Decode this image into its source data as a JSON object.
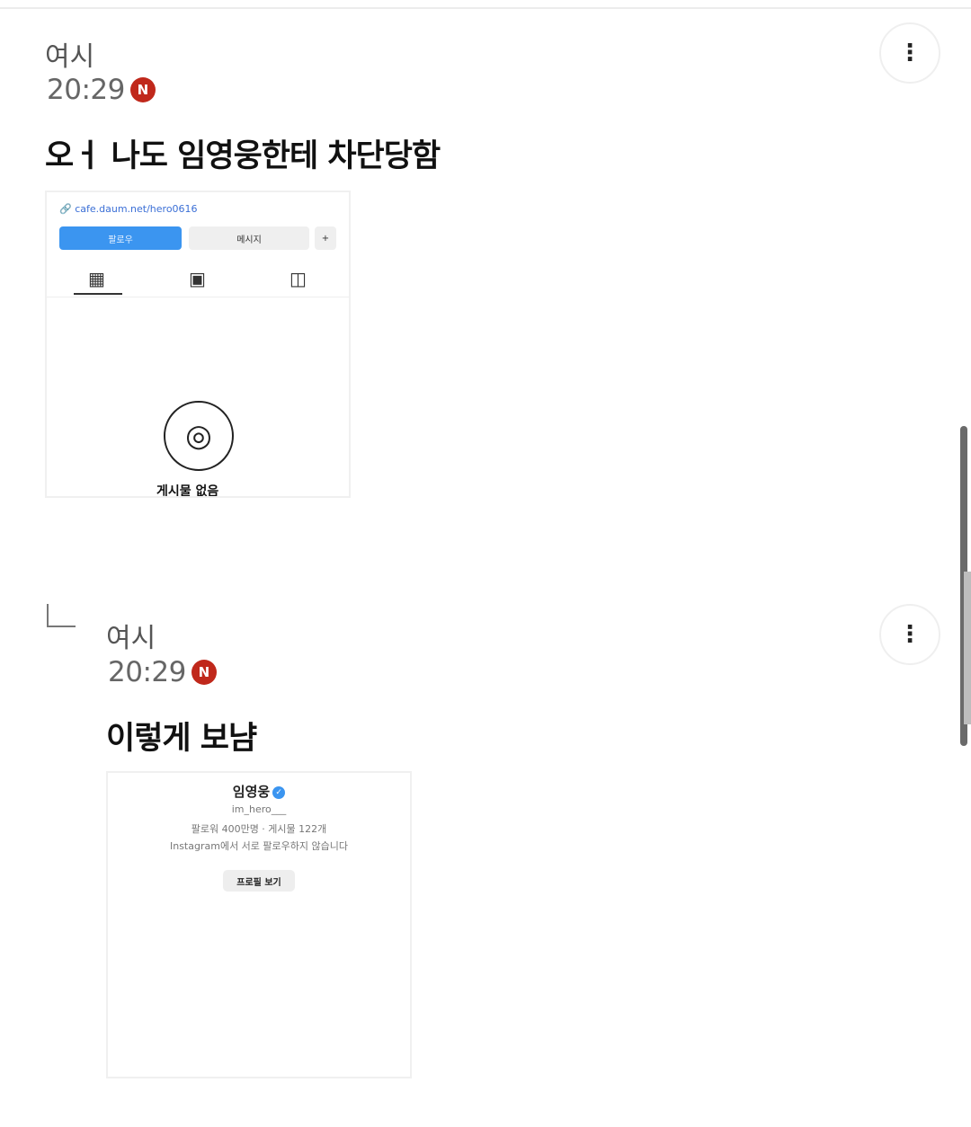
{
  "comments": [
    {
      "author": "여시",
      "time": "20:29",
      "badge": "N",
      "body": "오ㅓ 나도 임영웅한테 차단당함",
      "is_reply": false,
      "more_icon": "more-vertical-icon",
      "attachment": {
        "link_text": "cafe.daum.net/hero0616",
        "follow_label": "팔로우",
        "message_label": "메시지",
        "add_label": "+",
        "tabs": [
          "grid-icon",
          "reels-icon",
          "tagged-icon"
        ],
        "tab_glyphs": [
          "▦",
          "▣",
          "◫"
        ],
        "camera_icon": "camera-icon",
        "camera_glyph": "◎",
        "empty_text": "게시물 없음"
      }
    },
    {
      "author": "여시",
      "time": "20:29",
      "badge": "N",
      "body": "이렇게 보냠",
      "is_reply": true,
      "reply_icon": "reply-arrow-icon",
      "more_icon": "more-vertical-icon",
      "attachment": {
        "name": "임영웅",
        "verified_icon": "verified-badge-icon",
        "verified_glyph": "✓",
        "handle": "im_hero___",
        "stats": "팔로워 400만명 · 게시물 122개",
        "note": "Instagram에서 서로 팔로우하지 않습니다",
        "profile_button": "프로필 보기"
      }
    }
  ],
  "more_glyph": "⋮",
  "colors": {
    "badge": "#c0281b",
    "follow": "#3b95f0",
    "link": "#3b6fd6"
  }
}
